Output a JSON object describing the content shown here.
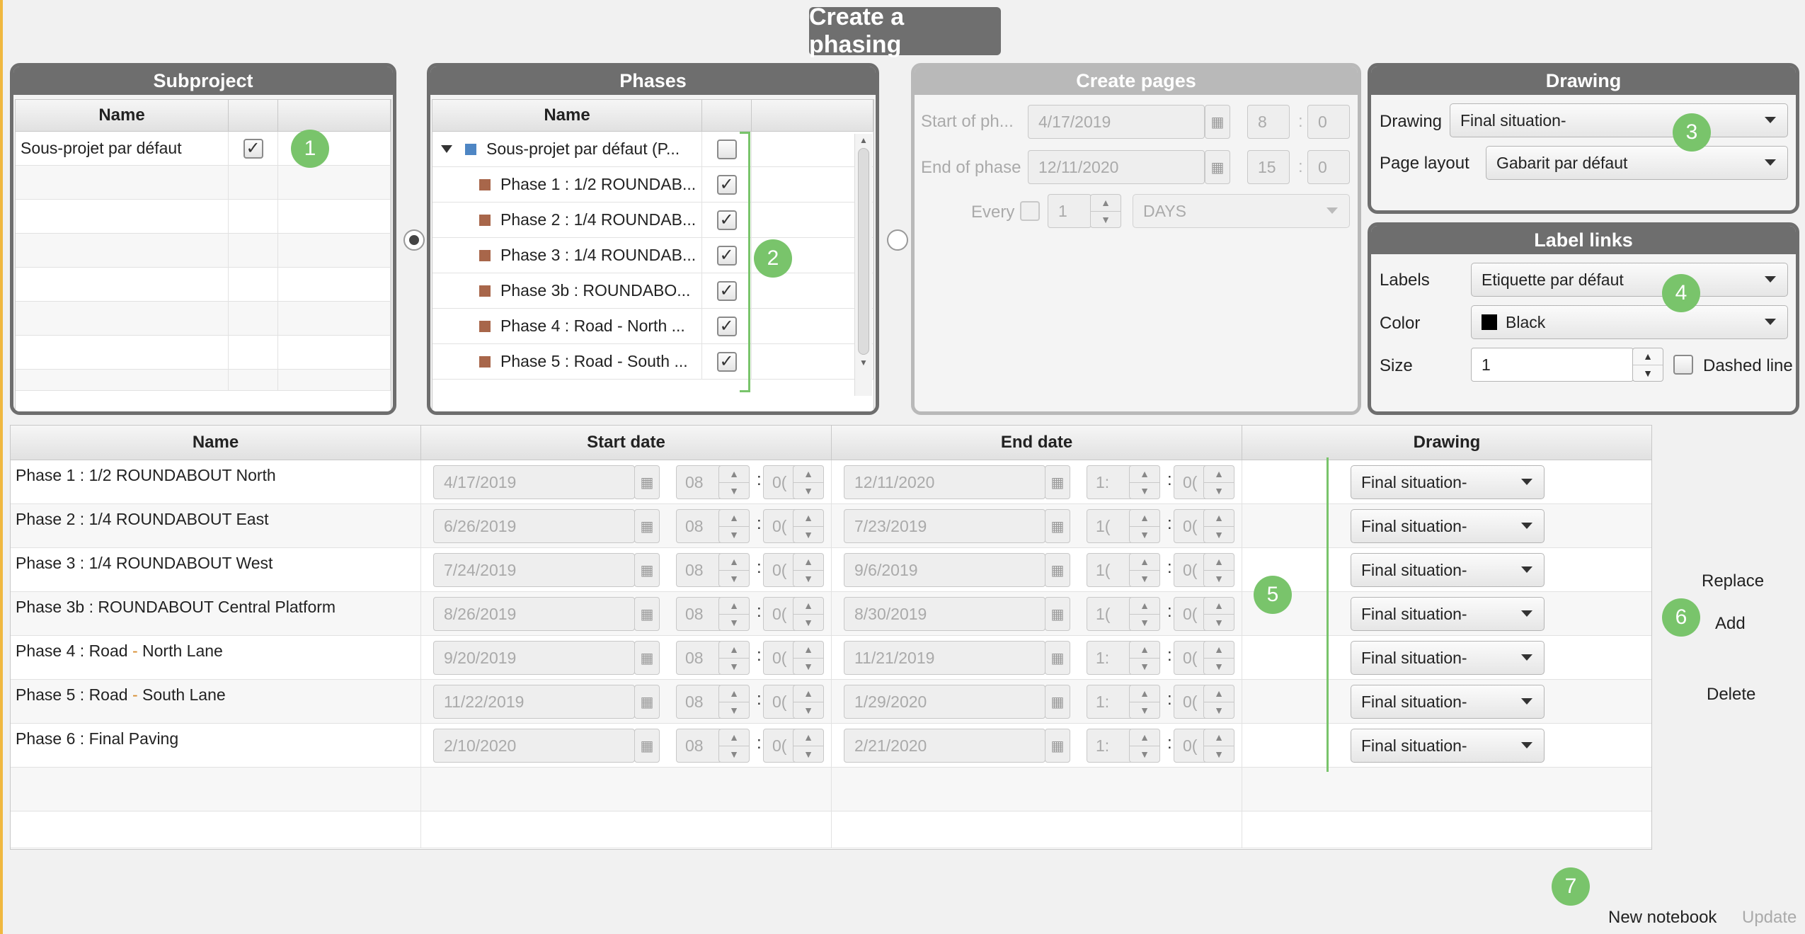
{
  "title": "Create a phasing",
  "subproject": {
    "header": "Subproject",
    "col_name": "Name",
    "rows": [
      {
        "name": "Sous-projet par défaut",
        "checked": true
      }
    ]
  },
  "phases": {
    "header": "Phases",
    "col_name": "Name",
    "root": {
      "name": "Sous-projet par défaut (P...",
      "color": "#4e86c4"
    },
    "items": [
      {
        "name": "Phase 1 : 1/2 ROUNDAB...",
        "color": "#a8664a",
        "checked": true
      },
      {
        "name": "Phase 2 : 1/4 ROUNDAB...",
        "color": "#a8664a",
        "checked": true
      },
      {
        "name": "Phase 3 : 1/4 ROUNDAB...",
        "color": "#a8664a",
        "checked": true
      },
      {
        "name": "Phase 3b : ROUNDABO...",
        "color": "#a8664a",
        "checked": true
      },
      {
        "name": "Phase 4 : Road - North ...",
        "color": "#a8664a",
        "checked": true
      },
      {
        "name": "Phase 5 : Road - South ...",
        "color": "#a8664a",
        "checked": true
      }
    ]
  },
  "create_pages": {
    "header": "Create pages",
    "start_label": "Start of ph...",
    "start_date": "4/17/2019",
    "start_hour": "8",
    "start_min": "0",
    "end_label": "End of phase",
    "end_date": "12/11/2020",
    "end_hour": "15",
    "end_min": "0",
    "every_label": "Every",
    "every_value": "1",
    "unit": "DAYS"
  },
  "drawing_panel": {
    "header": "Drawing",
    "drawing_label": "Drawing",
    "drawing_value": "Final situation-",
    "layout_label": "Page layout",
    "layout_value": "Gabarit par défaut"
  },
  "label_links": {
    "header": "Label links",
    "labels_label": "Labels",
    "labels_value": "Etiquette par défaut",
    "color_label": "Color",
    "color_value": "Black",
    "color_swatch": "#000000",
    "size_label": "Size",
    "size_value": "1",
    "dashed_label": "Dashed line"
  },
  "table": {
    "col_name": "Name",
    "col_start": "Start date",
    "col_end": "End date",
    "col_drawing": "Drawing",
    "rows": [
      {
        "name_a": "Phase 1 : 1/2 ROUNDABOUT North",
        "dash": "",
        "name_b": "",
        "start": "4/17/2019",
        "sh": "08",
        "sm": "0(",
        "end": "12/11/2020",
        "eh": "1:",
        "em": "0(",
        "drawing": "Final situation-"
      },
      {
        "name_a": "Phase 2 : 1/4 ROUNDABOUT East",
        "dash": "",
        "name_b": "",
        "start": "6/26/2019",
        "sh": "08",
        "sm": "0(",
        "end": "7/23/2019",
        "eh": "1(",
        "em": "0(",
        "drawing": "Final situation-"
      },
      {
        "name_a": "Phase 3 : 1/4 ROUNDABOUT West",
        "dash": "",
        "name_b": "",
        "start": "7/24/2019",
        "sh": "08",
        "sm": "0(",
        "end": "9/6/2019",
        "eh": "1(",
        "em": "0(",
        "drawing": "Final situation-"
      },
      {
        "name_a": "Phase 3b : ROUNDABOUT Central Platform",
        "dash": "",
        "name_b": "",
        "start": "8/26/2019",
        "sh": "08",
        "sm": "0(",
        "end": "8/30/2019",
        "eh": "1(",
        "em": "0(",
        "drawing": "Final situation-"
      },
      {
        "name_a": "Phase 4 : Road ",
        "dash": "-",
        "name_b": " North Lane",
        "start": "9/20/2019",
        "sh": "08",
        "sm": "0(",
        "end": "11/21/2019",
        "eh": "1:",
        "em": "0(",
        "drawing": "Final situation-"
      },
      {
        "name_a": "Phase 5 : Road ",
        "dash": "-",
        "name_b": " South Lane",
        "start": "11/22/2019",
        "sh": "08",
        "sm": "0(",
        "end": "1/29/2020",
        "eh": "1:",
        "em": "0(",
        "drawing": "Final situation-"
      },
      {
        "name_a": "Phase 6 : Final Paving",
        "dash": "",
        "name_b": "",
        "start": "2/10/2020",
        "sh": "08",
        "sm": "0(",
        "end": "2/21/2020",
        "eh": "1:",
        "em": "0(",
        "drawing": "Final situation-"
      }
    ]
  },
  "actions": {
    "replace": "Replace",
    "add": "Add",
    "delete": "Delete"
  },
  "footer": {
    "new_notebook": "New notebook",
    "update": "Update"
  },
  "badges": [
    "1",
    "2",
    "3",
    "4",
    "5",
    "6",
    "7"
  ],
  "colors": {
    "panel": "#6e6e6e",
    "badge": "#79c46b",
    "disabled_panel": "#b9b9b9"
  }
}
